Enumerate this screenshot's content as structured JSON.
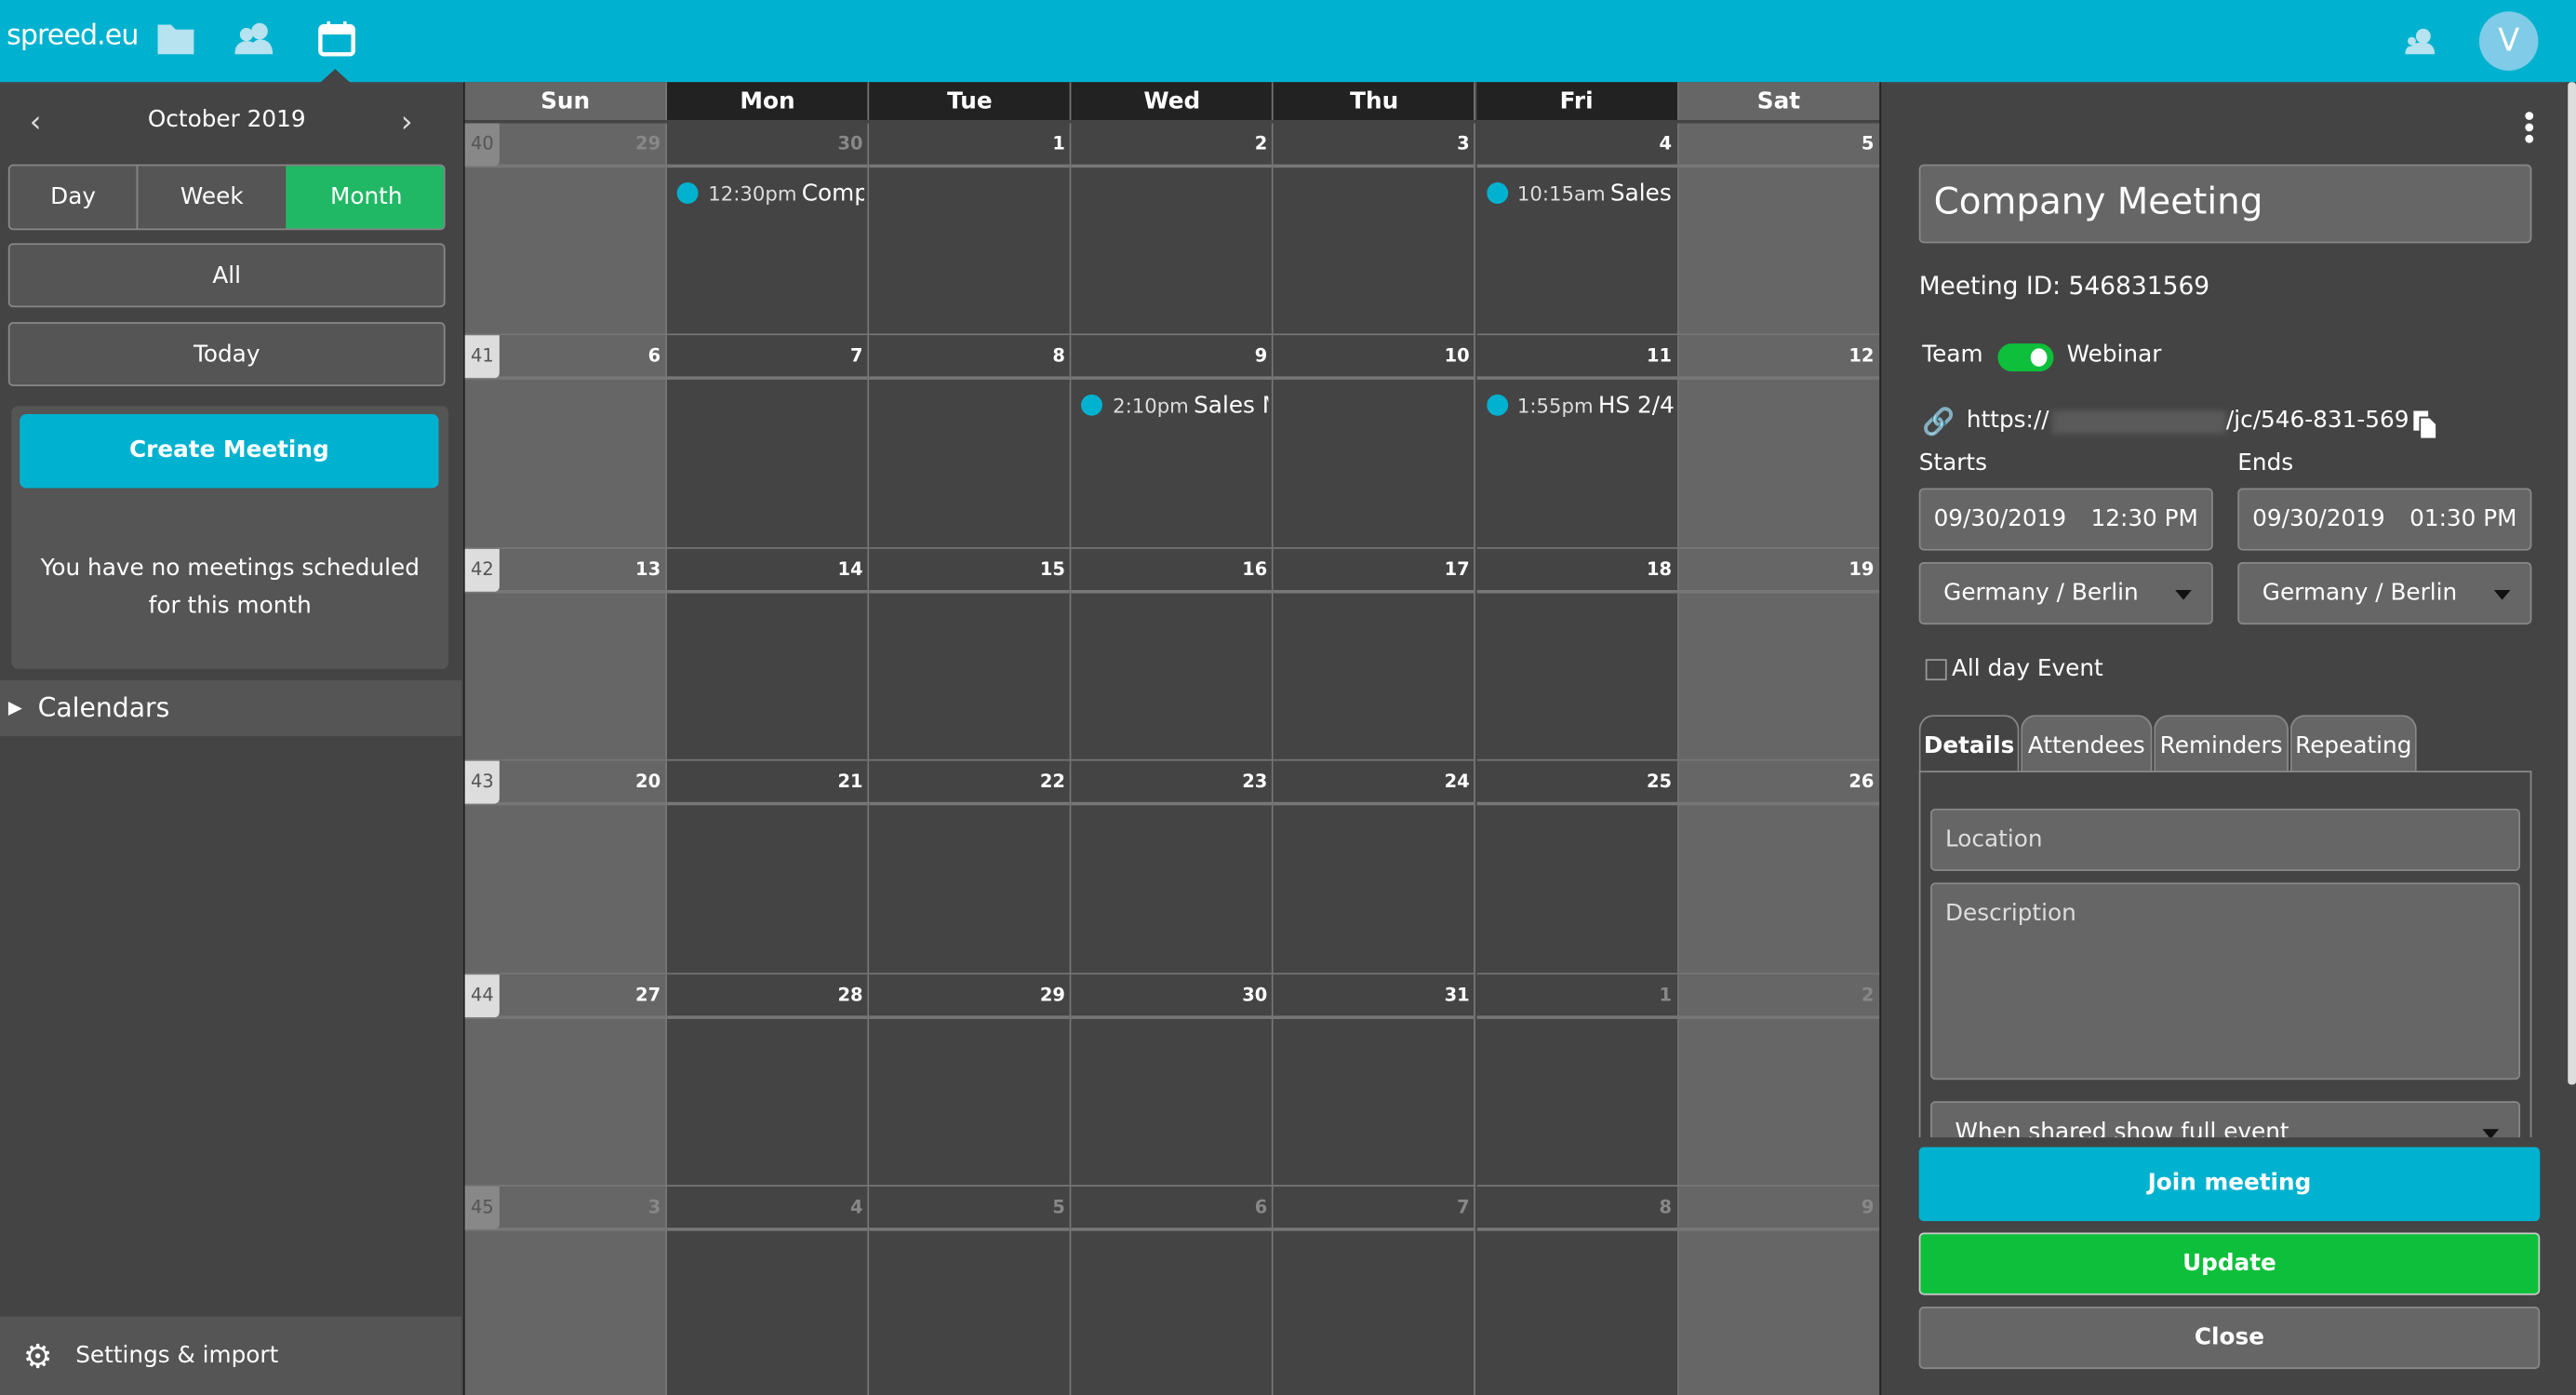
{
  "topbar": {
    "logo": "spreed.eu",
    "avatar_initial": "V",
    "nav": [
      "folder-icon",
      "contacts-icon",
      "calendar-icon"
    ],
    "accent": "#00b2cf"
  },
  "sidebar": {
    "month_label": "October 2019",
    "views": [
      "Day",
      "Week",
      "Month"
    ],
    "active_view": "Month",
    "all_label": "All",
    "today_label": "Today",
    "create_label": "Create Meeting",
    "empty_message": "You have no meetings scheduled for this month",
    "calendars_label": "Calendars",
    "settings_label": "Settings & import"
  },
  "calendar": {
    "day_headers": [
      "Sun",
      "Mon",
      "Tue",
      "Wed",
      "Thu",
      "Fri",
      "Sat"
    ],
    "weeks": [
      {
        "week": "40",
        "days": [
          [
            "29",
            1
          ],
          [
            "30",
            1
          ],
          [
            "1",
            0
          ],
          [
            "2",
            0
          ],
          [
            "3",
            0
          ],
          [
            "4",
            0
          ],
          [
            "5",
            0
          ]
        ]
      },
      {
        "week": "41",
        "days": [
          [
            "6",
            0
          ],
          [
            "7",
            0
          ],
          [
            "8",
            0
          ],
          [
            "9",
            0
          ],
          [
            "10",
            0
          ],
          [
            "11",
            0
          ],
          [
            "12",
            0
          ]
        ]
      },
      {
        "week": "42",
        "days": [
          [
            "13",
            0
          ],
          [
            "14",
            0
          ],
          [
            "15",
            0
          ],
          [
            "16",
            0
          ],
          [
            "17",
            0
          ],
          [
            "18",
            0
          ],
          [
            "19",
            0
          ]
        ]
      },
      {
        "week": "43",
        "days": [
          [
            "20",
            0
          ],
          [
            "21",
            0
          ],
          [
            "22",
            0
          ],
          [
            "23",
            0
          ],
          [
            "24",
            0
          ],
          [
            "25",
            0
          ],
          [
            "26",
            0
          ]
        ]
      },
      {
        "week": "44",
        "days": [
          [
            "27",
            0
          ],
          [
            "28",
            0
          ],
          [
            "29",
            0
          ],
          [
            "30",
            0
          ],
          [
            "31",
            0
          ],
          [
            "1",
            1
          ],
          [
            "2",
            1
          ]
        ]
      },
      {
        "week": "45",
        "days": [
          [
            "3",
            1
          ],
          [
            "4",
            1
          ],
          [
            "5",
            1
          ],
          [
            "6",
            1
          ],
          [
            "7",
            1
          ],
          [
            "8",
            1
          ],
          [
            "9",
            1
          ]
        ]
      }
    ],
    "events": [
      {
        "week": 0,
        "day": 1,
        "time": "12:30pm",
        "title": "Comp"
      },
      {
        "week": 0,
        "day": 5,
        "time": "10:15am",
        "title": "Sales M"
      },
      {
        "week": 1,
        "day": 3,
        "time": "2:10pm",
        "title": "Sales M"
      },
      {
        "week": 1,
        "day": 5,
        "time": "1:55pm",
        "title": "HS 2/4"
      }
    ]
  },
  "detail": {
    "title": "Company Meeting",
    "meeting_id": "Meeting ID: 546831569",
    "toggle_left": "Team",
    "toggle_right": "Webinar",
    "toggle_on": true,
    "link_prefix": "https://",
    "link_suffix": "/jc/546-831-569",
    "starts_label": "Starts",
    "ends_label": "Ends",
    "start_date": "09/30/2019",
    "start_time": "12:30 PM",
    "end_date": "09/30/2019",
    "end_time": "01:30 PM",
    "start_tz": "Germany / Berlin",
    "end_tz": "Germany / Berlin",
    "all_day_label": "All day Event",
    "all_day": false,
    "tabs": [
      "Details",
      "Attendees",
      "Reminders",
      "Repeating"
    ],
    "active_tab": "Details",
    "location_placeholder": "Location",
    "description_placeholder": "Description",
    "share_option": "When shared show full event",
    "join_label": "Join meeting",
    "update_label": "Update",
    "close_label": "Close",
    "update_color": "#0dbf3a"
  }
}
